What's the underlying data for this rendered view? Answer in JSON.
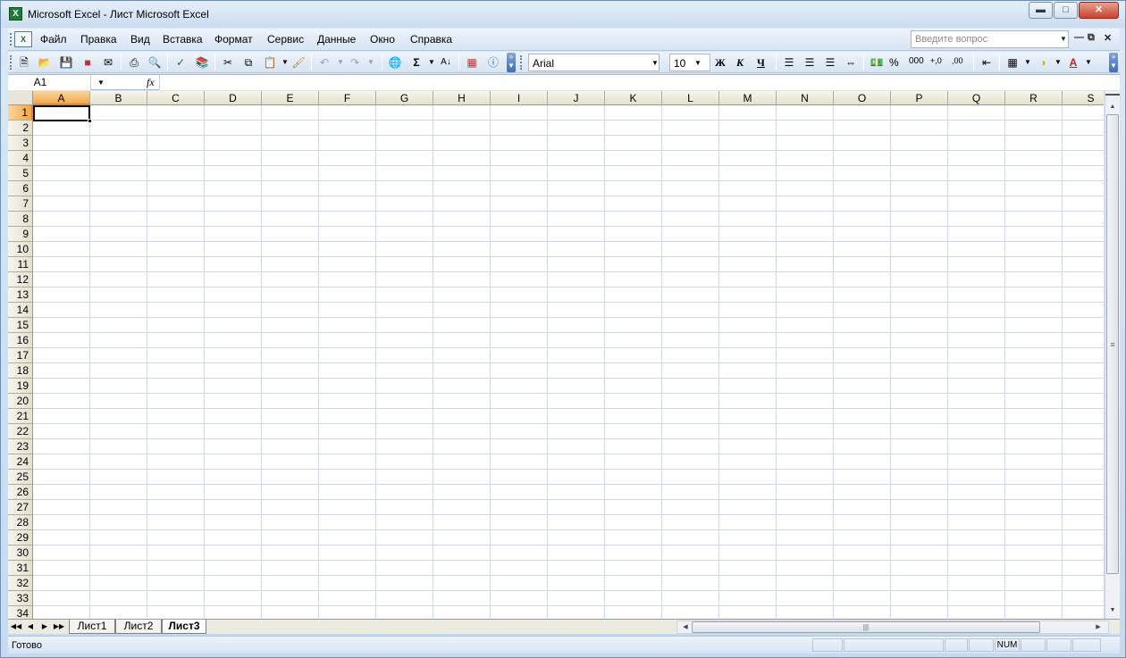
{
  "window": {
    "title": "Microsoft Excel - Лист Microsoft Excel",
    "app_icon": "excel-icon"
  },
  "menu": {
    "items": [
      "Файл",
      "Правка",
      "Вид",
      "Вставка",
      "Формат",
      "Сервис",
      "Данные",
      "Окно",
      "Справка"
    ],
    "help_placeholder": "Введите вопрос"
  },
  "toolbar": {
    "font": "Arial",
    "size": "10",
    "bold": "Ж",
    "italic": "К",
    "underline": "Ч",
    "percent": "%",
    "thousands": "000",
    "inc_decimal": "+,0",
    "dec_decimal": ",00"
  },
  "formula_bar": {
    "cell_ref": "A1",
    "fx": "fx",
    "value": ""
  },
  "grid": {
    "columns": [
      "A",
      "B",
      "C",
      "D",
      "E",
      "F",
      "G",
      "H",
      "I",
      "J",
      "K",
      "L",
      "M",
      "N",
      "O",
      "P",
      "Q",
      "R",
      "S"
    ],
    "rows": [
      "1",
      "2",
      "3",
      "4",
      "5",
      "6",
      "7",
      "8",
      "9",
      "10",
      "11",
      "12",
      "13",
      "14",
      "15",
      "16",
      "17",
      "18",
      "19",
      "20",
      "21",
      "22",
      "23",
      "24",
      "25",
      "26",
      "27",
      "28",
      "29",
      "30",
      "31",
      "32",
      "33",
      "34"
    ],
    "active_col": "A",
    "active_row": "1"
  },
  "sheets": {
    "tabs": [
      "Лист1",
      "Лист2",
      "Лист3"
    ],
    "active": "Лист3"
  },
  "status": {
    "text": "Готово",
    "num": "NUM"
  },
  "colors": {
    "accent": "#f2a74a",
    "titlebar": "#cadcf0",
    "gridline": "#d0d7e5"
  }
}
